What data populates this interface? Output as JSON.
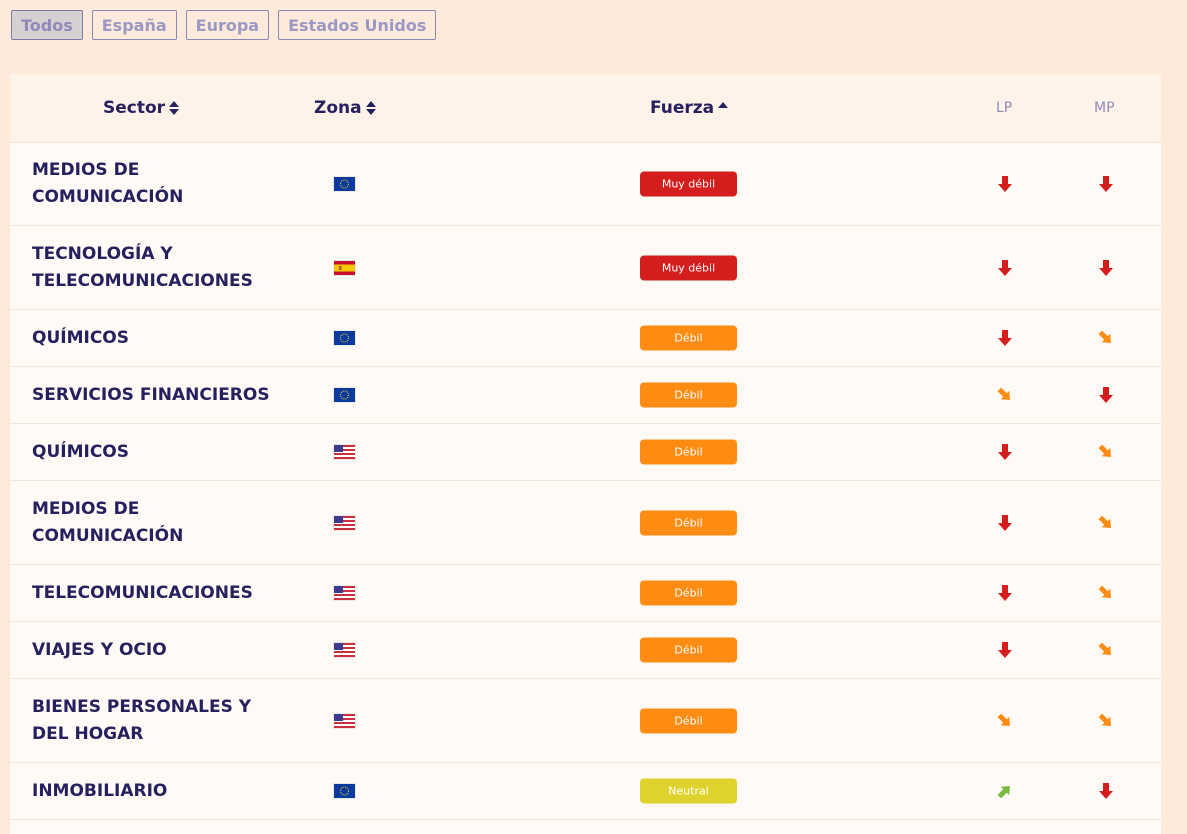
{
  "filters": [
    {
      "label": "Todos",
      "active": true
    },
    {
      "label": "España",
      "active": false
    },
    {
      "label": "Europa",
      "active": false
    },
    {
      "label": "Estados Unidos",
      "active": false
    }
  ],
  "headers": {
    "sector": "Sector",
    "zona": "Zona",
    "fuerza": "Fuerza",
    "lp": "LP",
    "mp": "MP"
  },
  "colors": {
    "muy_debil": "#d41e1e",
    "debil": "#ff8c12",
    "neutral": "#e0d22c",
    "down_red": "#d41e1e",
    "down_orange": "#ff8c12",
    "up_green": "#77bb3f"
  },
  "rows": [
    {
      "sector": "MEDIOS DE COMUNICACIÓN",
      "zona": "eu",
      "fuerza": "Muy débil",
      "fuerza_level": "muy_debil",
      "lp": "down",
      "mp": "down"
    },
    {
      "sector": "TECNOLOGÍA Y TELECOMUNICACIONES",
      "zona": "es",
      "fuerza": "Muy débil",
      "fuerza_level": "muy_debil",
      "lp": "down",
      "mp": "down"
    },
    {
      "sector": "QUÍMICOS",
      "zona": "eu",
      "fuerza": "Débil",
      "fuerza_level": "debil",
      "lp": "down",
      "mp": "down-right"
    },
    {
      "sector": "SERVICIOS FINANCIEROS",
      "zona": "eu",
      "fuerza": "Débil",
      "fuerza_level": "debil",
      "lp": "down-right",
      "mp": "down"
    },
    {
      "sector": "QUÍMICOS",
      "zona": "us",
      "fuerza": "Débil",
      "fuerza_level": "debil",
      "lp": "down",
      "mp": "down-right"
    },
    {
      "sector": "MEDIOS DE COMUNICACIÓN",
      "zona": "us",
      "fuerza": "Débil",
      "fuerza_level": "debil",
      "lp": "down",
      "mp": "down-right"
    },
    {
      "sector": "TELECOMUNICACIONES",
      "zona": "us",
      "fuerza": "Débil",
      "fuerza_level": "debil",
      "lp": "down",
      "mp": "down-right"
    },
    {
      "sector": "VIAJES Y OCIO",
      "zona": "us",
      "fuerza": "Débil",
      "fuerza_level": "debil",
      "lp": "down",
      "mp": "down-right"
    },
    {
      "sector": "BIENES PERSONALES Y DEL HOGAR",
      "zona": "us",
      "fuerza": "Débil",
      "fuerza_level": "debil",
      "lp": "down-right",
      "mp": "down-right"
    },
    {
      "sector": "INMOBILIARIO",
      "zona": "eu",
      "fuerza": "Neutral",
      "fuerza_level": "neutral",
      "lp": "up-right",
      "mp": "down"
    }
  ]
}
